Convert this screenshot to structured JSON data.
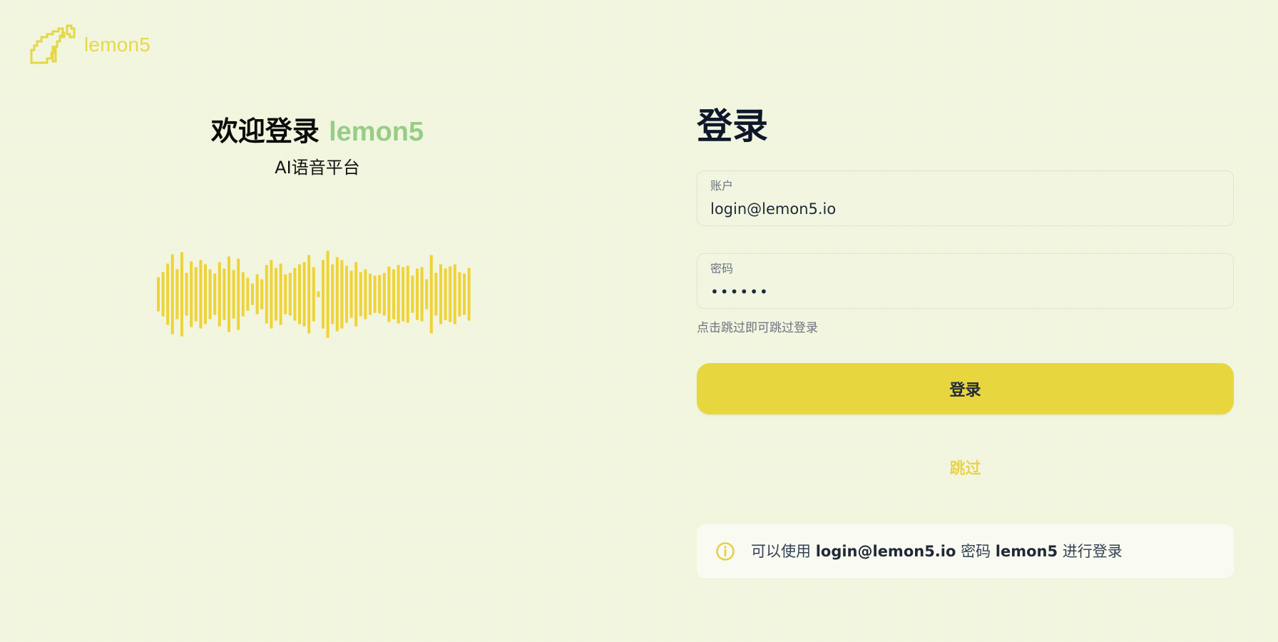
{
  "brand": {
    "name": "lemon5",
    "logo_icon": "lemon-pixel-icon"
  },
  "hero": {
    "title_prefix": "欢迎登录",
    "title_brand": "lemon5",
    "subtitle": "AI语音平台",
    "waveform_icon": "audio-waveform-icon"
  },
  "login": {
    "title": "登录",
    "account": {
      "label": "账户",
      "value": "login@lemon5.io"
    },
    "password": {
      "label": "密码",
      "value": "••••••"
    },
    "hint": "点击跳过即可跳过登录",
    "submit_label": "登录",
    "skip_label": "跳过",
    "info": {
      "icon": "info-circle-icon",
      "prefix": "可以使用",
      "email": "login@lemon5.io",
      "middle": "密码",
      "password": "lemon5",
      "suffix": "进行登录"
    }
  },
  "colors": {
    "background": "#f1f5dd",
    "accent_yellow": "#e8d63e",
    "brand_green": "#97cd87",
    "text_dark": "#111827",
    "muted": "#6b7280"
  }
}
